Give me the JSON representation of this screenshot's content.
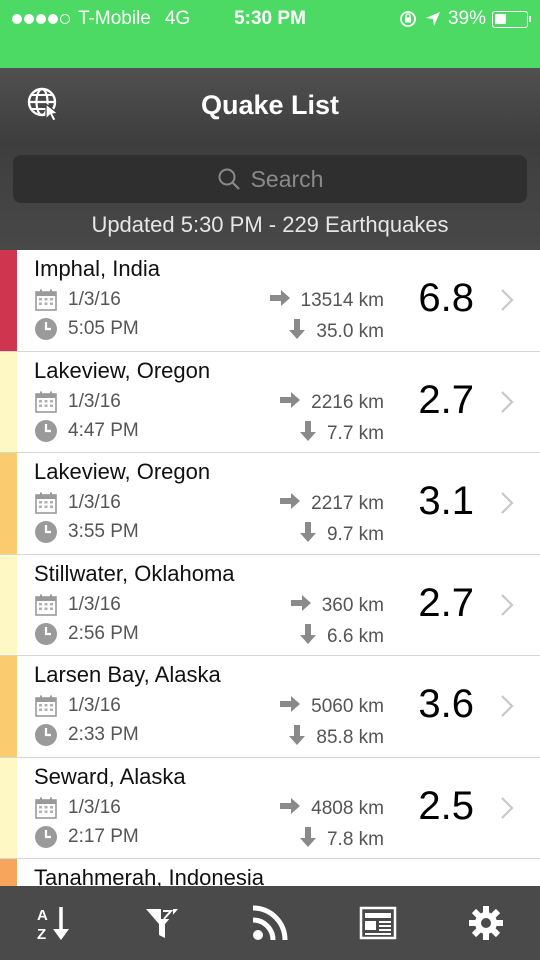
{
  "status_bar": {
    "carrier": "T-Mobile",
    "network": "4G",
    "time": "5:30 PM",
    "battery": "39%",
    "battery_level": 0.39,
    "signal_bars": 4
  },
  "nav": {
    "title": "Quake List",
    "globe_icon": "globe-cursor-icon"
  },
  "search": {
    "placeholder": "Search"
  },
  "updated_text": "Updated 5:30 PM - 229 Earthquakes",
  "quakes": [
    {
      "place": "Imphal, India",
      "date": "1/3/16",
      "time": "5:05 PM",
      "distance": "13514 km",
      "depth": "35.0 km",
      "magnitude": "6.8",
      "color": "#d0354f"
    },
    {
      "place": "Lakeview, Oregon",
      "date": "1/3/16",
      "time": "4:47 PM",
      "distance": "2216 km",
      "depth": "7.7 km",
      "magnitude": "2.7",
      "color": "#fdf8c4"
    },
    {
      "place": "Lakeview, Oregon",
      "date": "1/3/16",
      "time": "3:55 PM",
      "distance": "2217 km",
      "depth": "9.7 km",
      "magnitude": "3.1",
      "color": "#fbcb6f"
    },
    {
      "place": "Stillwater, Oklahoma",
      "date": "1/3/16",
      "time": "2:56 PM",
      "distance": "360 km",
      "depth": "6.6 km",
      "magnitude": "2.7",
      "color": "#fdf8c4"
    },
    {
      "place": "Larsen Bay, Alaska",
      "date": "1/3/16",
      "time": "2:33 PM",
      "distance": "5060 km",
      "depth": "85.8 km",
      "magnitude": "3.6",
      "color": "#fbcb6f"
    },
    {
      "place": "Seward, Alaska",
      "date": "1/3/16",
      "time": "2:17 PM",
      "distance": "4808 km",
      "depth": "7.8 km",
      "magnitude": "2.5",
      "color": "#fdf8c4"
    },
    {
      "place": "Tanahmerah, Indonesia",
      "date": "",
      "time": "",
      "distance": "",
      "depth": "",
      "magnitude": "",
      "color": "#f7a45c"
    }
  ],
  "tabbar": [
    {
      "name": "sort-az-icon"
    },
    {
      "name": "filter-icon"
    },
    {
      "name": "rss-feed-icon"
    },
    {
      "name": "news-icon"
    },
    {
      "name": "settings-gear-icon"
    }
  ],
  "colors": {
    "status_green": "#4cd964",
    "header_dark": "#444444",
    "tab_dark": "#4a4a4a"
  }
}
